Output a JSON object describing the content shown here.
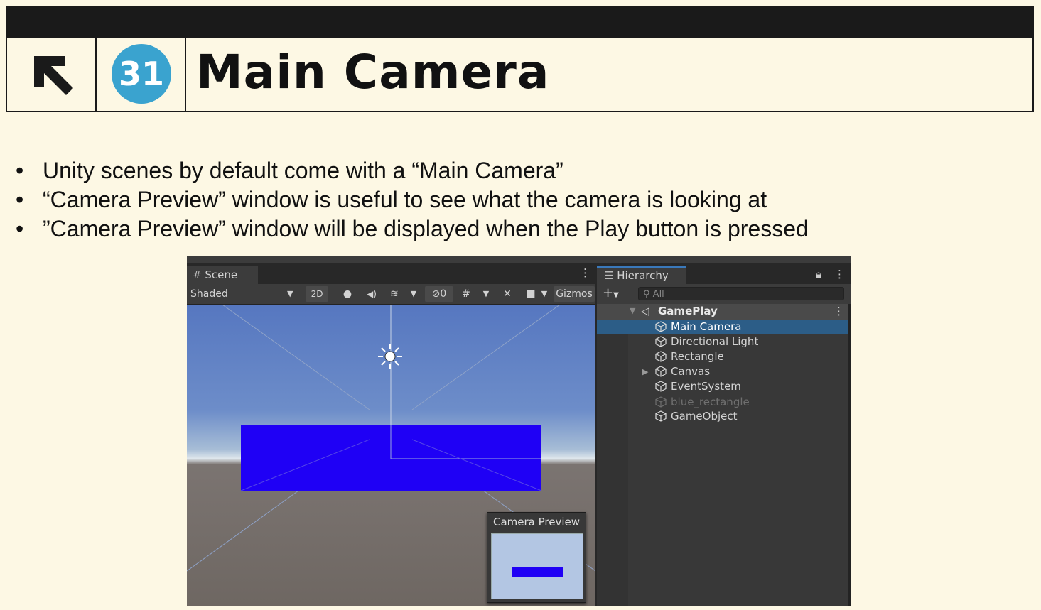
{
  "slide": {
    "number": "31",
    "title": "Main Camera",
    "bullets": [
      "Unity scenes by default come with a “Main Camera”",
      "“Camera Preview” window is useful to see what the camera is looking at",
      "”Camera Preview” window will be displayed when the Play button is pressed"
    ]
  },
  "scene_view": {
    "tab_label": "Scene",
    "shading_mode": "Shaded",
    "mode_2d": "2D",
    "hidden_count": "0",
    "gizmos_label": "Gizmos",
    "camera_preview_title": "Camera Preview"
  },
  "hierarchy": {
    "tab_label": "Hierarchy",
    "search_placeholder": "All",
    "scene_name": "GamePlay",
    "items": [
      {
        "label": "Main Camera",
        "selected": true
      },
      {
        "label": "Directional Light"
      },
      {
        "label": "Rectangle"
      },
      {
        "label": "Canvas",
        "expandable": true
      },
      {
        "label": "EventSystem"
      },
      {
        "label": "blue_rectangle",
        "inactive": true
      },
      {
        "label": "GameObject"
      }
    ]
  },
  "colors": {
    "accent_circle": "#3aa3cf",
    "selection": "#2c5d87",
    "rectangle": "#1f00f5"
  }
}
